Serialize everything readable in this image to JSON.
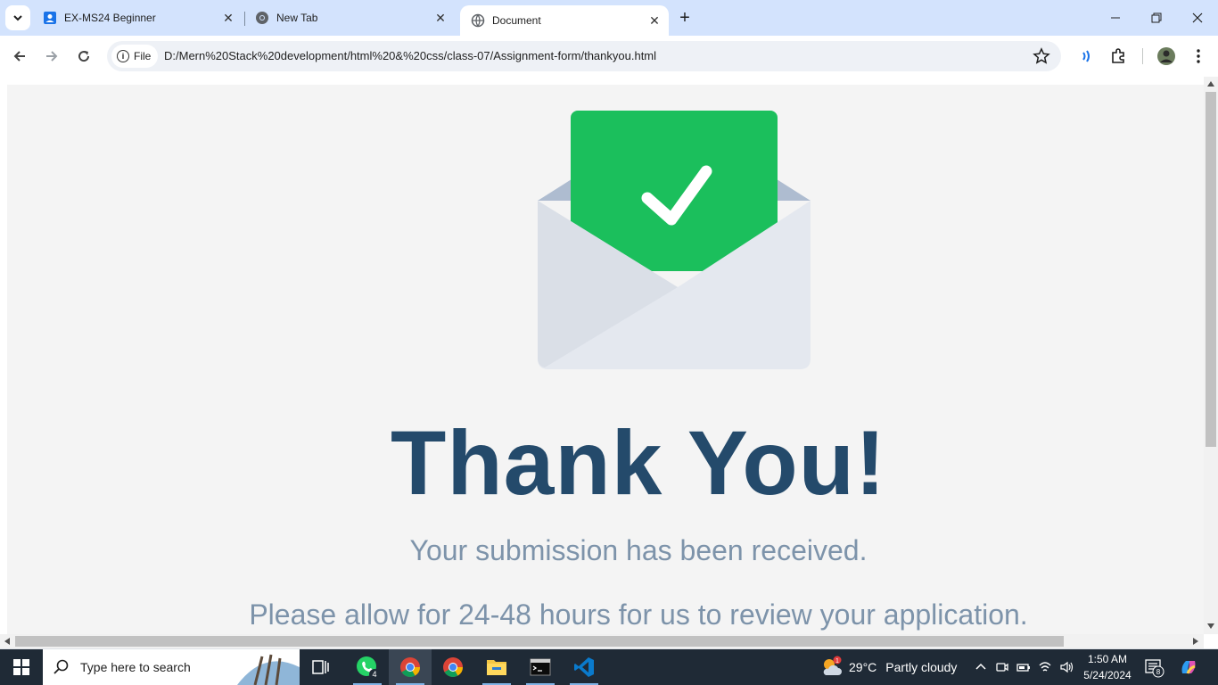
{
  "browser": {
    "tabs": [
      {
        "title": "EX-MS24 Beginner",
        "icon": "person-doc-icon",
        "active": false
      },
      {
        "title": "New Tab",
        "icon": "chrome-icon",
        "active": false
      },
      {
        "title": "Document",
        "icon": "globe-icon",
        "active": true
      }
    ],
    "address_chip": "File",
    "url": "D:/Mern%20Stack%20development/html%20&%20css/class-07/Assignment-form/thankyou.html"
  },
  "page": {
    "heading": "Thank You!",
    "line1": "Your submission has been received.",
    "line2": "Please allow for 24-48 hours for us to review your application.",
    "colors": {
      "heading": "#244a6b",
      "text": "#7d93aa",
      "check_card": "#1bbf5c",
      "envelope": "#e3e7ee"
    }
  },
  "taskbar": {
    "search_placeholder": "Type here to search",
    "whatsapp_badge": "4",
    "weather": {
      "temp": "29°C",
      "condition": "Partly cloudy",
      "badge": "1"
    },
    "time": "1:50 AM",
    "date": "5/24/2024",
    "notifications": "8"
  }
}
